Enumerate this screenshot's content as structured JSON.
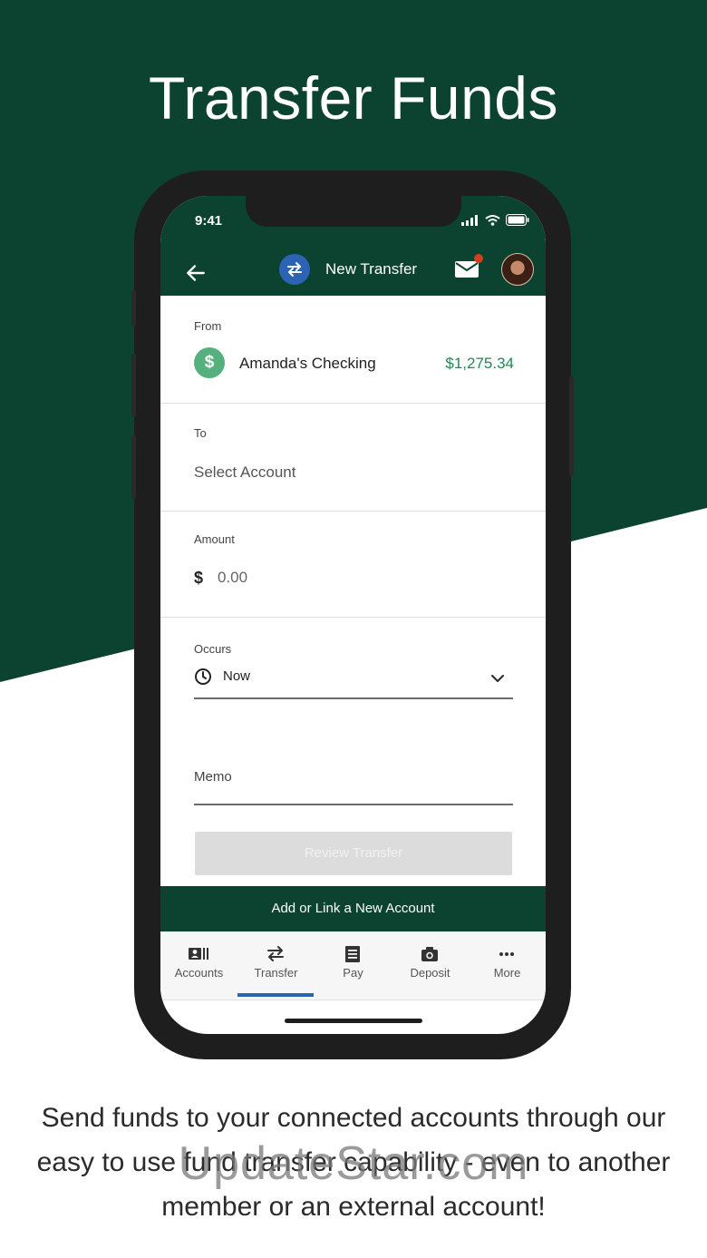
{
  "promo": {
    "headline": "Transfer Funds",
    "caption": "Send funds to your connected accounts through our easy to use fund transfer capability - even to another member or an external account!",
    "watermark": "UpdateStar.com"
  },
  "status_bar": {
    "time": "9:41"
  },
  "app_bar": {
    "title": "New Transfer"
  },
  "form": {
    "from": {
      "label": "From",
      "account_name": "Amanda's Checking",
      "balance": "$1,275.34",
      "icon": "$"
    },
    "to": {
      "label": "To",
      "placeholder": "Select Account"
    },
    "amount": {
      "label": "Amount",
      "currency": "$",
      "value": "0.00"
    },
    "occurs": {
      "label": "Occurs",
      "value": "Now"
    },
    "memo": {
      "label": "Memo"
    },
    "review_button": "Review Transfer"
  },
  "link_bar": {
    "label": "Add or Link a New Account"
  },
  "tabs": [
    {
      "label": "Accounts",
      "icon": "accounts-icon"
    },
    {
      "label": "Transfer",
      "icon": "transfer-icon",
      "active": true
    },
    {
      "label": "Pay",
      "icon": "pay-icon"
    },
    {
      "label": "Deposit",
      "icon": "camera-icon"
    },
    {
      "label": "More",
      "icon": "more-icon"
    }
  ],
  "colors": {
    "brand_green": "#0c4330",
    "accent_blue": "#2c63b5",
    "balance_green": "#1f8a55",
    "notification": "#d0401e"
  }
}
